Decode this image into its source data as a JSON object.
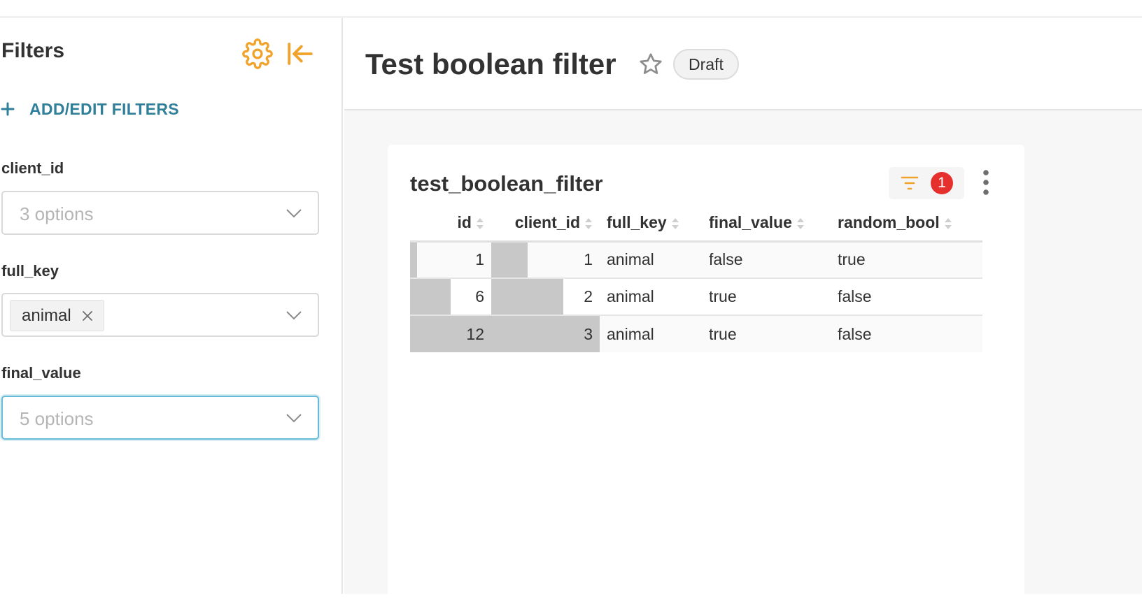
{
  "sidebar": {
    "title": "Filters",
    "add_edit_label": "ADD/EDIT FILTERS",
    "filters": [
      {
        "label": "client_id",
        "placeholder": "3 options",
        "focused": false
      },
      {
        "label": "full_key",
        "selected_tag": "animal",
        "focused": false
      },
      {
        "label": "final_value",
        "placeholder": "5 options",
        "focused": true
      }
    ]
  },
  "header": {
    "title": "Test boolean filter",
    "status": "Draft"
  },
  "chart": {
    "title": "test_boolean_filter",
    "filter_count": "1",
    "columns": [
      "id",
      "client_id",
      "full_key",
      "final_value",
      "random_bool"
    ],
    "rows": [
      {
        "id": 1,
        "client_id": 1,
        "full_key": "animal",
        "final_value": "false",
        "random_bool": "true"
      },
      {
        "id": 6,
        "client_id": 2,
        "full_key": "animal",
        "final_value": "true",
        "random_bool": "false"
      },
      {
        "id": 12,
        "client_id": 3,
        "full_key": "animal",
        "final_value": "true",
        "random_bool": "false"
      }
    ]
  },
  "colors": {
    "accent_orange": "#f0a22a",
    "link_teal": "#2f7f9a",
    "badge_red": "#e5302d",
    "cell_bar": "#c8c8c8"
  },
  "icons": {
    "settings": "gear-icon",
    "collapse": "collapse-left-icon",
    "add": "plus-icon",
    "favorite": "star-icon",
    "filter": "filter-icon",
    "more": "kebab-icon"
  }
}
